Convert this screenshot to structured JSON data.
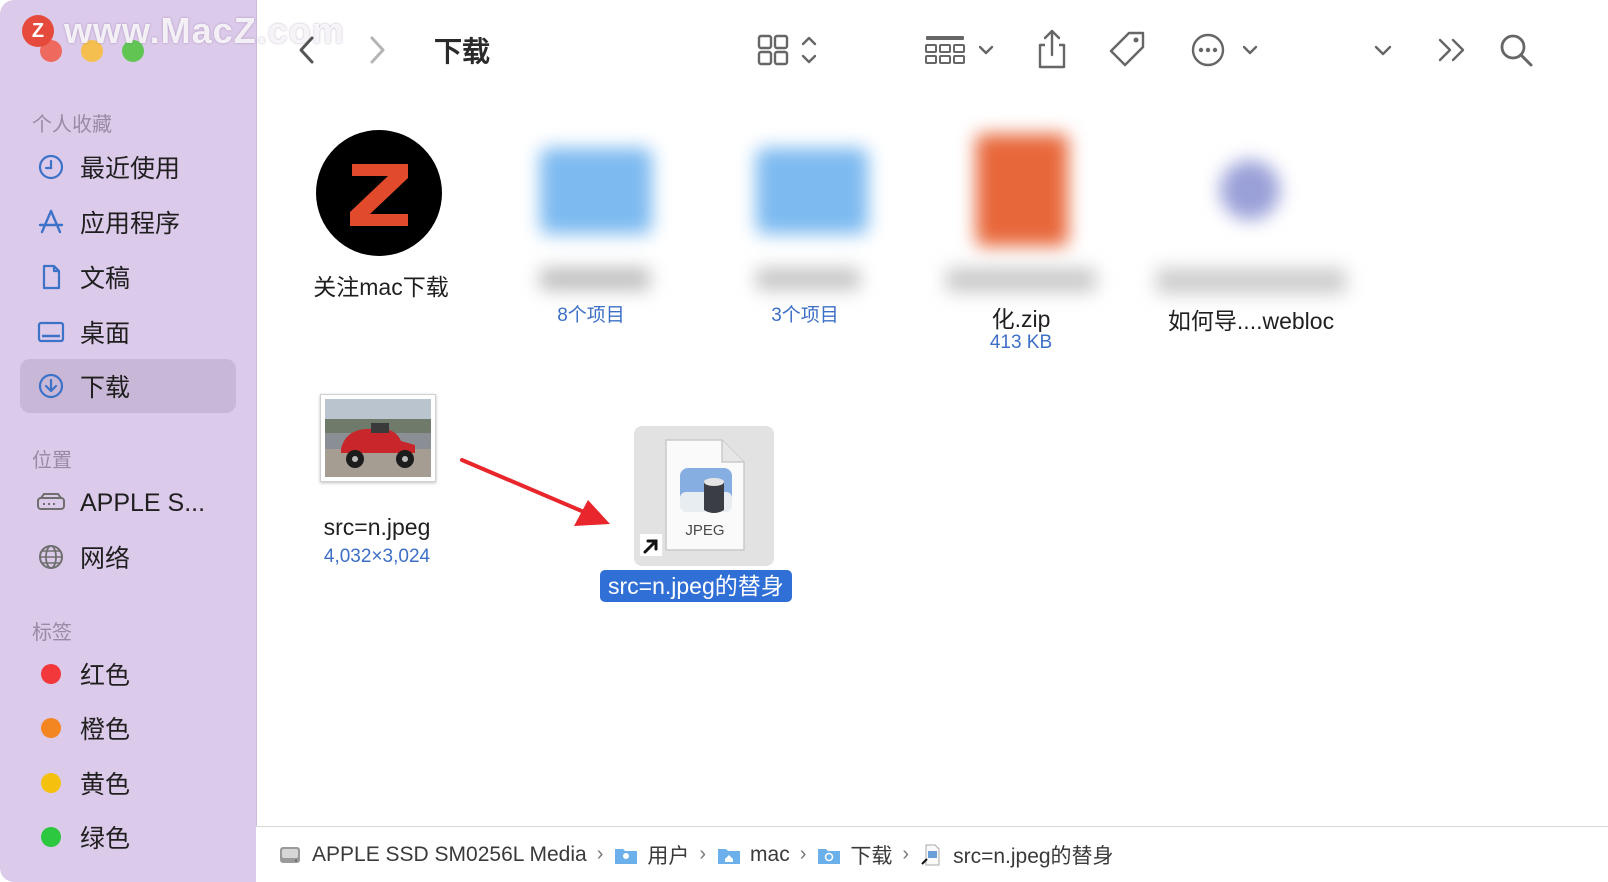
{
  "watermark": "www.MacZ.com",
  "window": {
    "title": "下载"
  },
  "sidebar": {
    "favorites_title": "个人收藏",
    "favorites": [
      {
        "label": "最近使用",
        "icon": "clock-icon"
      },
      {
        "label": "应用程序",
        "icon": "apps-icon"
      },
      {
        "label": "文稿",
        "icon": "document-icon"
      },
      {
        "label": "桌面",
        "icon": "desktop-icon"
      },
      {
        "label": "下载",
        "icon": "download-icon",
        "active": true
      }
    ],
    "locations_title": "位置",
    "locations": [
      {
        "label": "APPLE S...",
        "icon": "drive-icon"
      },
      {
        "label": "网络",
        "icon": "globe-icon"
      }
    ],
    "tags_title": "标签",
    "tags": [
      {
        "label": "红色",
        "color": "#f2383b"
      },
      {
        "label": "橙色",
        "color": "#f48621"
      },
      {
        "label": "黄色",
        "color": "#f4c10f"
      },
      {
        "label": "绿色",
        "color": "#2bc840"
      }
    ]
  },
  "files": [
    {
      "name": "关注mac下载",
      "sub": ""
    },
    {
      "name": "",
      "sub": "8个项目"
    },
    {
      "name": "",
      "sub": "3个项目"
    },
    {
      "name": "化.zip",
      "sub": "413 KB"
    },
    {
      "name": "如何导....webloc",
      "sub": ""
    },
    {
      "name": "src=n.jpeg",
      "sub": "4,032×3,024"
    },
    {
      "name": "src=n.jpeg的替身",
      "sub": "",
      "selected": true,
      "badge": "JPEG"
    }
  ],
  "pathbar": [
    "APPLE SSD SM0256L Media",
    "用户",
    "mac",
    "下载",
    "src=n.jpeg的替身"
  ],
  "colors": {
    "sidebar": "#dccaea",
    "accent": "#2f6fd6",
    "arrow": "#e8262c"
  }
}
